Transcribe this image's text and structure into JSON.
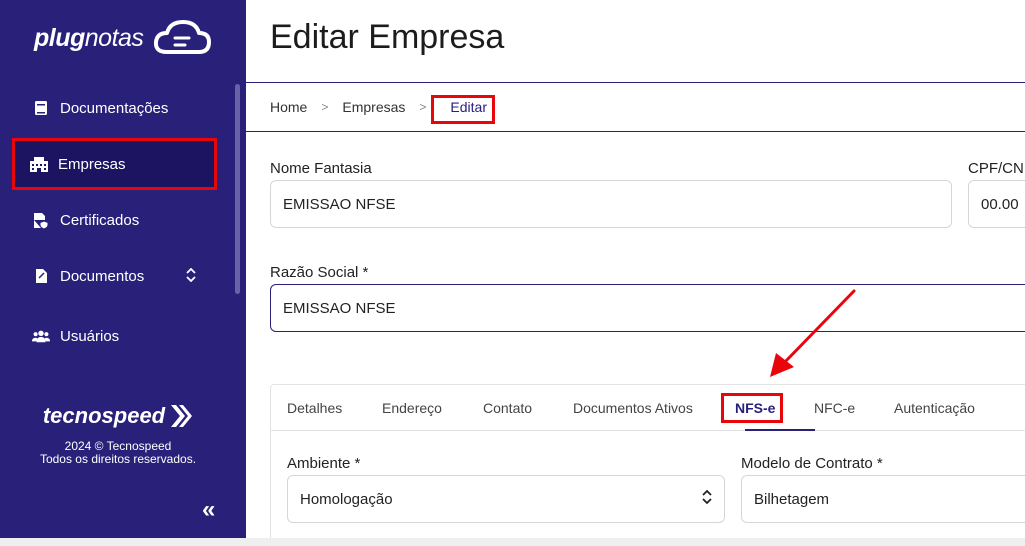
{
  "sidebar": {
    "logo_bold": "plug",
    "logo_light": "notas",
    "items": [
      {
        "label": "Documentações",
        "icon": "book-icon"
      },
      {
        "label": "Empresas",
        "icon": "building-icon"
      },
      {
        "label": "Certificados",
        "icon": "certificate-icon"
      },
      {
        "label": "Documentos",
        "icon": "document-icon"
      },
      {
        "label": "Usuários",
        "icon": "users-icon"
      }
    ],
    "brand": "tecnospeed",
    "copyright_line1": "2024 © Tecnospeed",
    "copyright_line2": "Todos os direitos reservados.",
    "collapse_glyph": "«"
  },
  "header": {
    "title": "Editar Empresa"
  },
  "breadcrumb": {
    "home": "Home",
    "empresas": "Empresas",
    "current": "Editar"
  },
  "form": {
    "nome_fantasia_label": "Nome Fantasia",
    "nome_fantasia_value": "EMISSAO NFSE",
    "cpf_label": "CPF/CN",
    "cpf_value": "00.00",
    "razao_social_label": "Razão Social *",
    "razao_social_value": "EMISSAO NFSE"
  },
  "tabs": [
    {
      "label": "Detalhes"
    },
    {
      "label": "Endereço"
    },
    {
      "label": "Contato"
    },
    {
      "label": "Documentos Ativos"
    },
    {
      "label": "NFS-e"
    },
    {
      "label": "NFC-e"
    },
    {
      "label": "Autenticação"
    }
  ],
  "nfse": {
    "ambiente_label": "Ambiente *",
    "ambiente_value": "Homologação",
    "modelo_label": "Modelo de Contrato *",
    "modelo_value": "Bilhetagem"
  },
  "colors": {
    "sidebar_bg": "#29207a",
    "highlight": "#e8060b",
    "accent": "#29207a"
  }
}
